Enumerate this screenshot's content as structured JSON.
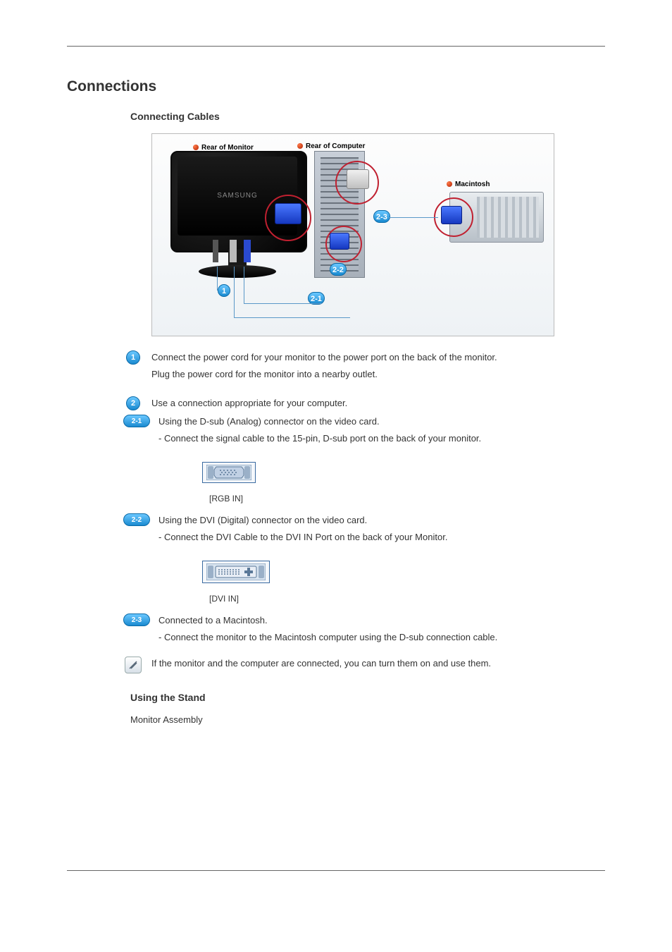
{
  "header": {
    "title": "Connections"
  },
  "section": {
    "cables_heading": "Connecting Cables"
  },
  "diagram": {
    "label_monitor": "Rear of Monitor",
    "label_computer": "Rear of Computer",
    "label_mac": "Macintosh",
    "monitor_brand": "SAMSUNG",
    "badge_1": "1",
    "badge_2_1": "2-1",
    "badge_2_2": "2-2",
    "badge_2_3": "2-3"
  },
  "steps": {
    "s1_text": "Connect the power cord for your monitor to the power port on the back of the monitor.",
    "s1_sub": "Plug the power cord for the monitor into a nearby outlet.",
    "s2_text": "Use a connection appropriate for your computer.",
    "s21_text": "Using the D-sub (Analog) connector on the video card.",
    "s21_sub": "- Connect the signal cable to the 15-pin, D-sub port on the back of your monitor.",
    "s21_port_label": "[RGB IN]",
    "s22_text": "Using the DVI (Digital) connector on the video card.",
    "s22_sub": "- Connect the DVI Cable to the DVI IN Port on the back of your Monitor.",
    "s22_port_label": "[DVI IN]",
    "s23_text": "Connected to a Macintosh.",
    "s23_sub": "- Connect the monitor to the Macintosh computer using the D-sub connection cable.",
    "note_text": "If the monitor and the computer are connected, you can turn them on and use them.",
    "badge_1": "1",
    "badge_2": "2",
    "badge_2_1": "2-1",
    "badge_2_2": "2-2",
    "badge_2_3": "2-3"
  },
  "stand": {
    "heading": "Using the Stand",
    "sub": "Monitor Assembly"
  }
}
